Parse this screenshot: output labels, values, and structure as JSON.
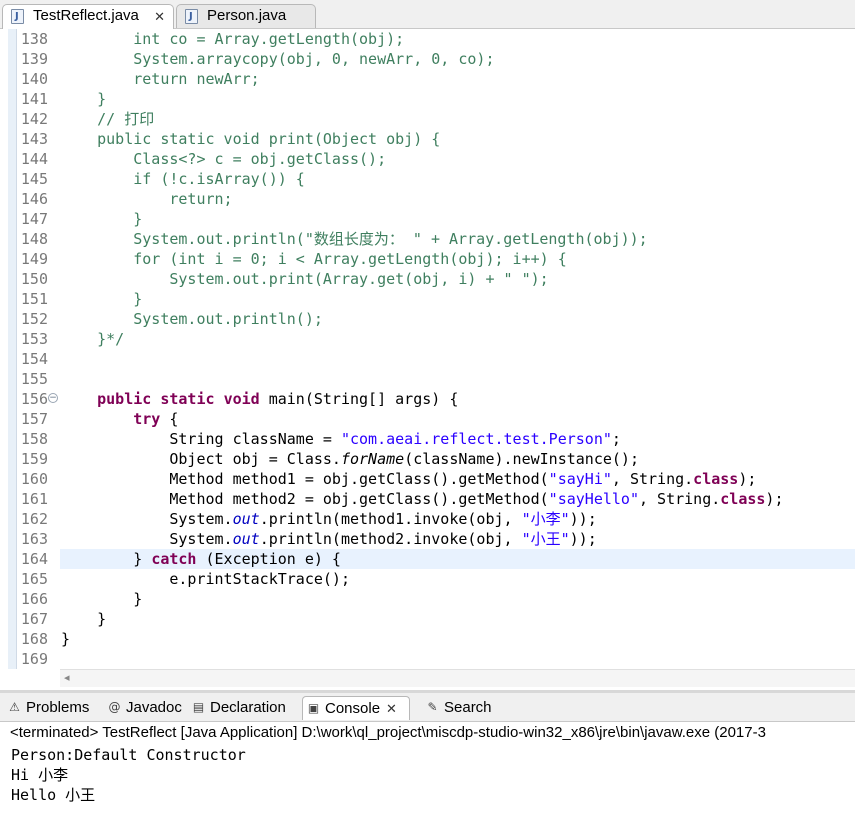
{
  "editor_tabs": [
    {
      "label": "TestReflect.java",
      "close": "✕"
    },
    {
      "label": "Person.java"
    }
  ],
  "code": {
    "l138": {
      "n": "138",
      "a": "        ",
      "b": "int co = Array.getLength(obj);"
    },
    "l139": {
      "n": "139",
      "a": "        ",
      "b": "System.arraycopy(obj, 0, newArr, 0, co);"
    },
    "l140": {
      "n": "140",
      "a": "        ",
      "b": "return newArr;"
    },
    "l141": {
      "n": "141",
      "a": "    ",
      "b": "}"
    },
    "l142": {
      "n": "142",
      "a": "    ",
      "b": "// 打印"
    },
    "l143": {
      "n": "143",
      "a": "    ",
      "b": "public static void print(Object obj) {"
    },
    "l144": {
      "n": "144",
      "a": "        ",
      "b": "Class<?> c = obj.getClass();"
    },
    "l145": {
      "n": "145",
      "a": "        ",
      "b": "if (!c.isArray()) {"
    },
    "l146": {
      "n": "146",
      "a": "            ",
      "b": "return;"
    },
    "l147": {
      "n": "147",
      "a": "        ",
      "b": "}"
    },
    "l148": {
      "n": "148",
      "a": "        ",
      "b": "System.out.println(\"数组长度为： \" + Array.getLength(obj));"
    },
    "l149": {
      "n": "149",
      "a": "        ",
      "b": "for (int i = 0; i < Array.getLength(obj); i++) {"
    },
    "l150": {
      "n": "150",
      "a": "            ",
      "b": "System.out.print(Array.get(obj, i) + \" \");"
    },
    "l151": {
      "n": "151",
      "a": "        ",
      "b": "}"
    },
    "l152": {
      "n": "152",
      "a": "        ",
      "b": "System.out.println();"
    },
    "l153": {
      "n": "153",
      "a": "    ",
      "b": "}*/"
    },
    "l154": {
      "n": "154"
    },
    "l155": {
      "n": "155"
    },
    "l156": {
      "n": "156",
      "a": "    ",
      "k1": "public",
      "s1": " ",
      "k2": "static",
      "s2": " ",
      "k3": "void",
      "c": " main(String[] args) {"
    },
    "l157": {
      "n": "157",
      "a": "        ",
      "k1": "try",
      "c": " {"
    },
    "l158": {
      "n": "158",
      "a": "            ",
      "b": "String className = ",
      "s": "\"com.aeai.reflect.test.Person\"",
      "c": ";"
    },
    "l159": {
      "n": "159",
      "a": "            ",
      "b": "Object obj = Class.",
      "i": "forName",
      "c": "(className).newInstance();"
    },
    "l160": {
      "n": "160",
      "a": "            ",
      "b": "Method method1 = obj.getClass().getMethod(",
      "s": "\"sayHi\"",
      "c": ", String.",
      "k": "class",
      "d": ");"
    },
    "l161": {
      "n": "161",
      "a": "            ",
      "b": "Method method2 = obj.getClass().getMethod(",
      "s": "\"sayHello\"",
      "c": ", String.",
      "k": "class",
      "d": ");"
    },
    "l162": {
      "n": "162",
      "a": "            ",
      "b": "System.",
      "i": "out",
      "c": ".println(method1.invoke(obj, ",
      "s": "\"小李\"",
      "d": "));"
    },
    "l163": {
      "n": "163",
      "a": "            ",
      "b": "System.",
      "i": "out",
      "c": ".println(method2.invoke(obj, ",
      "s": "\"小王\"",
      "d": "));"
    },
    "l164": {
      "n": "164",
      "a": "        ",
      "b": "} ",
      "k": "catch",
      "c": " (Exception e) {"
    },
    "l165": {
      "n": "165",
      "a": "            ",
      "b": "e.printStackTrace();"
    },
    "l166": {
      "n": "166",
      "a": "        ",
      "b": "}"
    },
    "l167": {
      "n": "167",
      "a": "    ",
      "b": "}"
    },
    "l168": {
      "n": "168",
      "b": "}"
    },
    "l169": {
      "n": "169"
    }
  },
  "fold_marker": "−",
  "scroll_arrow": "◂",
  "panel_tabs": {
    "problems": {
      "label": "Problems",
      "icon": "⚠"
    },
    "javadoc": {
      "label": "Javadoc",
      "icon": "@"
    },
    "declaration": {
      "label": "Declaration",
      "icon": "▤"
    },
    "console": {
      "label": "Console",
      "icon": "▣",
      "close": "✕"
    },
    "search": {
      "label": "Search",
      "icon": "✎"
    }
  },
  "console": {
    "header": "<terminated> TestReflect [Java Application] D:\\work\\ql_project\\miscdp-studio-win32_x86\\jre\\bin\\javaw.exe (2017-3",
    "lines": [
      "Person:Default Constructor",
      "Hi 小李",
      "Hello 小王"
    ]
  },
  "colors": {
    "keyword": "#7f0055",
    "string": "#2a00ff",
    "comment": "#3f7f5f",
    "static_field": "#0000c0",
    "line_number": "#787878",
    "current_line": "#e8f2fe"
  }
}
